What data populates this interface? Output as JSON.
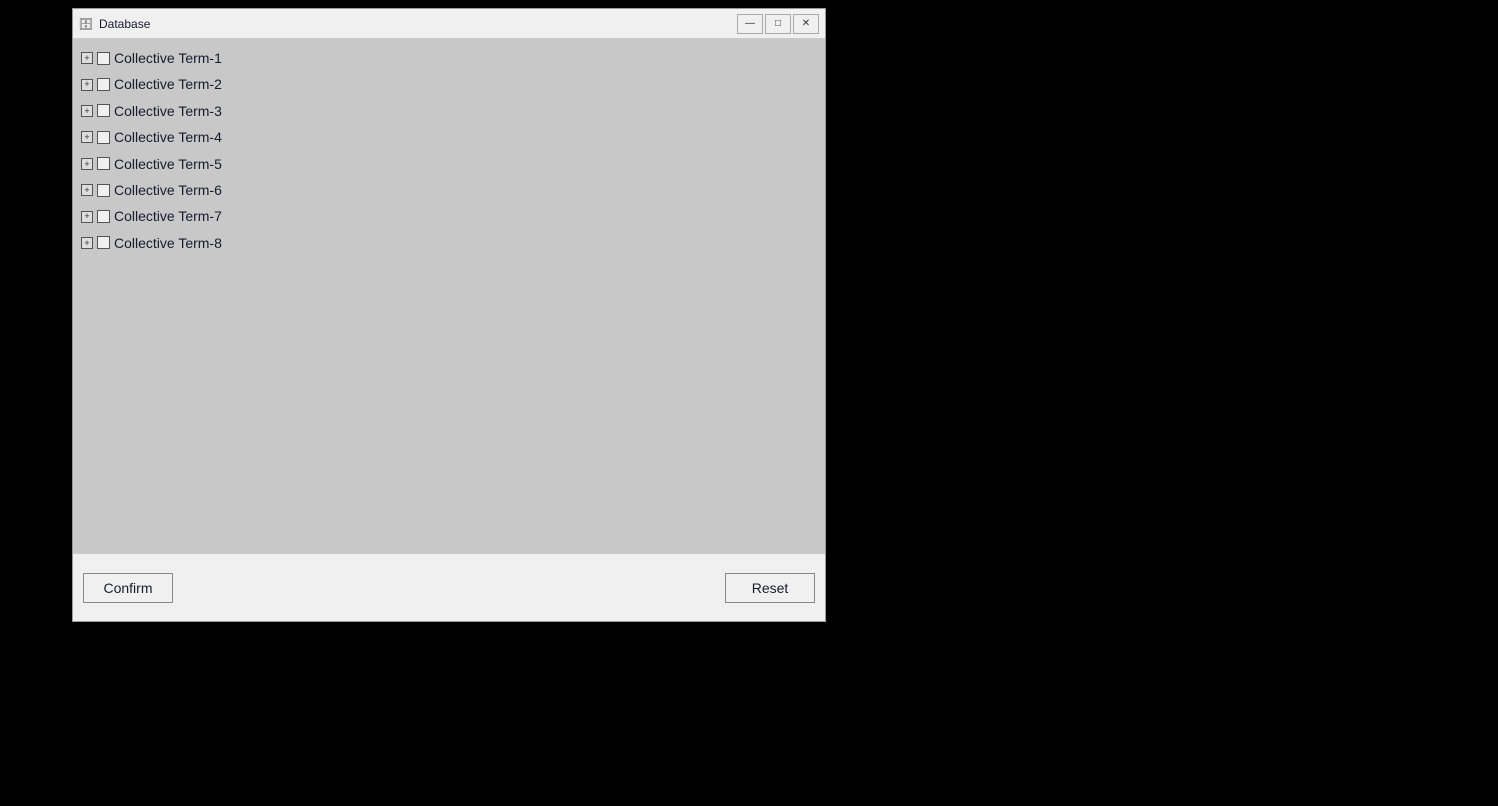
{
  "window": {
    "title": "Database",
    "title_icon": "🗄",
    "controls": {
      "minimize": "—",
      "maximize": "□",
      "close": "✕"
    }
  },
  "tree": {
    "items": [
      {
        "id": 1,
        "label": "Collective Term-1"
      },
      {
        "id": 2,
        "label": "Collective Term-2"
      },
      {
        "id": 3,
        "label": "Collective Term-3"
      },
      {
        "id": 4,
        "label": "Collective Term-4"
      },
      {
        "id": 5,
        "label": "Collective Term-5"
      },
      {
        "id": 6,
        "label": "Collective Term-6"
      },
      {
        "id": 7,
        "label": "Collective Term-7"
      },
      {
        "id": 8,
        "label": "Collective Term-8"
      }
    ]
  },
  "buttons": {
    "confirm": "Confirm",
    "reset": "Reset"
  }
}
